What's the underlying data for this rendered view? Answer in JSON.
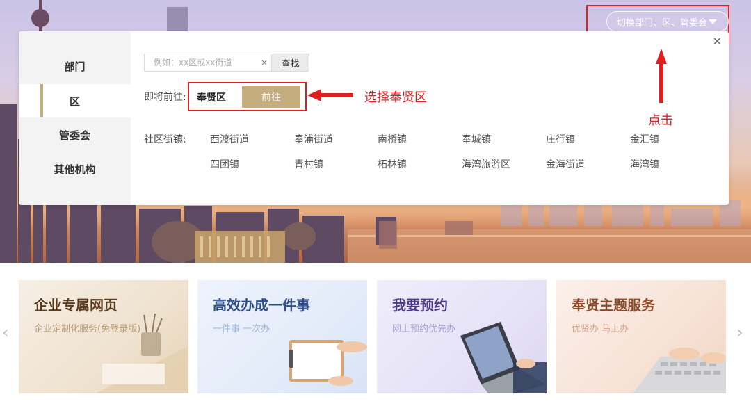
{
  "header": {
    "switch_label": "切换部门、区、管委会"
  },
  "sidebar": {
    "items": [
      {
        "label": "部门"
      },
      {
        "label": "区"
      },
      {
        "label": "管委会"
      },
      {
        "label": "其他机构"
      }
    ],
    "active_index": 1
  },
  "search": {
    "placeholder": "例如：xx区或xx街道",
    "clear": "×",
    "button": "查找"
  },
  "goto": {
    "label": "即将前往:",
    "name": "奉贤区",
    "button": "前往"
  },
  "community": {
    "label": "社区街镇:",
    "row1": [
      "西渡街道",
      "奉浦街道",
      "南桥镇",
      "奉城镇",
      "庄行镇",
      "金汇镇"
    ],
    "row2": [
      "四团镇",
      "青村镇",
      "柘林镇",
      "海湾旅游区",
      "金海街道",
      "海湾镇"
    ]
  },
  "annotations": {
    "select_text": "选择奉贤区",
    "click_text": "点击",
    "color": "#e01f1f"
  },
  "cards": [
    {
      "title": "企业专属网页",
      "subtitle": "企业定制化服务(免登录版)",
      "title_color": "#5a3b1f",
      "sub_color": "#b79a76"
    },
    {
      "title": "高效办成一件事",
      "subtitle": "一件事 一次办",
      "title_color": "#2f4f8a",
      "sub_color": "#9fb6d9"
    },
    {
      "title": "我要预约",
      "subtitle": "网上预约优先办",
      "title_color": "#4a3a86",
      "sub_color": "#a79cd1"
    },
    {
      "title": "奉贤主题服务",
      "subtitle": "优贤办 马上办",
      "title_color": "#8a4a2a",
      "sub_color": "#d6a58c"
    }
  ],
  "carousel": {
    "prev": "‹",
    "next": "›"
  },
  "colors": {
    "accent_gold": "#c6ad7d",
    "highlight_red": "#e01f1f"
  }
}
